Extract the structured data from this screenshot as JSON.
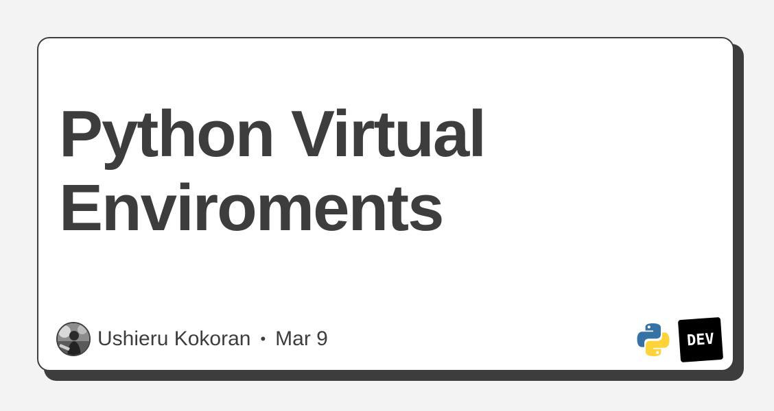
{
  "post": {
    "title": "Python Virtual Enviroments",
    "author": "Ushieru Kokoran",
    "separator": "•",
    "date": "Mar 9"
  },
  "logos": {
    "tag_logo_icon": "python-logo-icon",
    "site_logo_text": "DEV"
  },
  "colors": {
    "ink": "#3d3d3d",
    "background": "#f3f3f3",
    "card": "#ffffff",
    "python_blue": "#3672a4",
    "python_yellow": "#ffd43b"
  }
}
